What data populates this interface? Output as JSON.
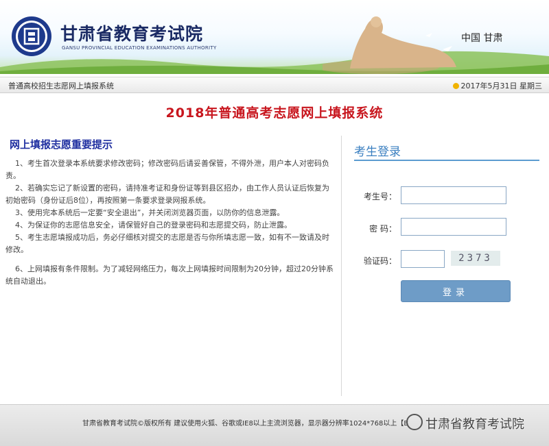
{
  "header": {
    "org_name": "甘肃省教育考试院",
    "org_name_en": "GANSU PROVINCIAL EDUCATION EXAMINATIONS AUTHORITY",
    "region": "中国 甘肃"
  },
  "nav": {
    "system_name": "普通高校招生志愿网上填报系统",
    "date": "2017年5月31日 星期三"
  },
  "main_title": "2018年普通高考志愿网上填报系统",
  "notice": {
    "heading": "网上填报志愿重要提示",
    "items": [
      "1、考生首次登录本系统要求修改密码；修改密码后请妥善保管，不得外泄，用户本人对密码负责。",
      "2、若确实忘记了新设置的密码，请持准考证和身份证等到县区招办，由工作人员认证后恢复为初始密码（身份证后8位），再按照第一条要求登录网报系统。",
      "3、使用完本系统后一定要“安全退出”，并关闭浏览器页面，以防你的信息泄露。",
      "4、为保证你的志愿信息安全，请保管好自己的登录密码和志愿提交码，防止泄露。",
      "5、考生志愿填报成功后，务必仔细核对提交的志愿是否与你所填志愿一致，如有不一致请及时修改。",
      "6、上网填报有条件限制。为了减轻网络压力，每次上网填报时间限制为20分钟，超过20分钟系统自动退出。"
    ]
  },
  "login": {
    "title": "考生登录",
    "exam_no_label": "考生号：",
    "password_label": "密 码：",
    "captcha_label": "验证码：",
    "captcha_text": "2373",
    "exam_no_value": "",
    "password_value": "",
    "captcha_value": "",
    "button_label": "登录"
  },
  "footer": {
    "text": "甘肃省教育考试院©版权所有 建议使用火狐、谷歌或IE8以上主流浏览器，显示器分辨率1024*768以上【B",
    "watermark": "甘肃省教育考试院"
  },
  "colors": {
    "title_red": "#c8161e",
    "heading_blue": "#1f2fa0",
    "login_accent": "#3a7fc0",
    "button": "#6e9cc7"
  }
}
